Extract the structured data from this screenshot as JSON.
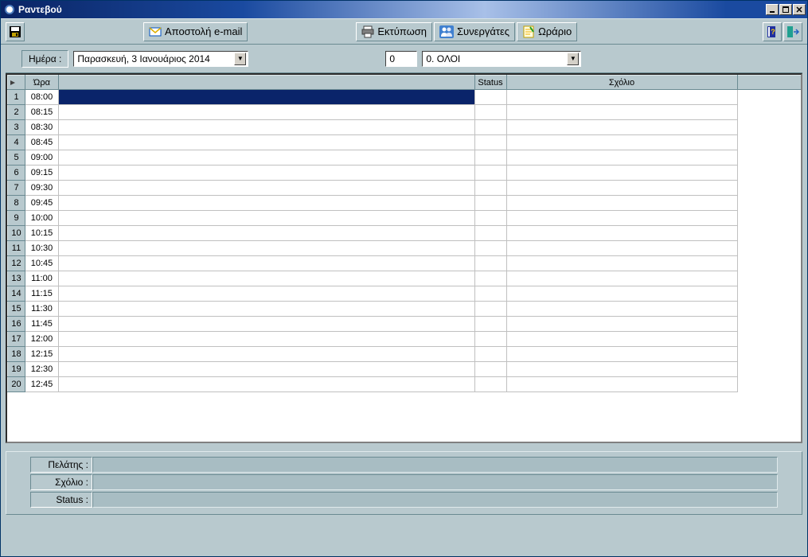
{
  "window": {
    "title": "Ραντεβού"
  },
  "toolbar": {
    "email_label": "Αποστολή e-mail",
    "print_label": "Εκτύπωση",
    "partners_label": "Συνεργάτες",
    "schedule_label": "Ωράριο"
  },
  "filter": {
    "day_label": "Ημέρα :",
    "date_value": "Παρασκευή, 3 Ιανουάριος 2014",
    "num_value": "0",
    "select_value": "0. ΟΛΟΙ"
  },
  "grid": {
    "headers": {
      "time": "Ώρα",
      "status": "Status",
      "comment": "Σχόλιο"
    },
    "rows": [
      {
        "n": "1",
        "time": "08:00",
        "selected": true
      },
      {
        "n": "2",
        "time": "08:15"
      },
      {
        "n": "3",
        "time": "08:30"
      },
      {
        "n": "4",
        "time": "08:45"
      },
      {
        "n": "5",
        "time": "09:00"
      },
      {
        "n": "6",
        "time": "09:15"
      },
      {
        "n": "7",
        "time": "09:30"
      },
      {
        "n": "8",
        "time": "09:45"
      },
      {
        "n": "9",
        "time": "10:00"
      },
      {
        "n": "10",
        "time": "10:15"
      },
      {
        "n": "11",
        "time": "10:30"
      },
      {
        "n": "12",
        "time": "10:45"
      },
      {
        "n": "13",
        "time": "11:00"
      },
      {
        "n": "14",
        "time": "11:15"
      },
      {
        "n": "15",
        "time": "11:30"
      },
      {
        "n": "16",
        "time": "11:45"
      },
      {
        "n": "17",
        "time": "12:00"
      },
      {
        "n": "18",
        "time": "12:15"
      },
      {
        "n": "19",
        "time": "12:30"
      },
      {
        "n": "20",
        "time": "12:45"
      }
    ]
  },
  "bottom": {
    "customer_label": "Πελάτης :",
    "comment_label": "Σχόλιο :",
    "status_label": "Status :"
  }
}
